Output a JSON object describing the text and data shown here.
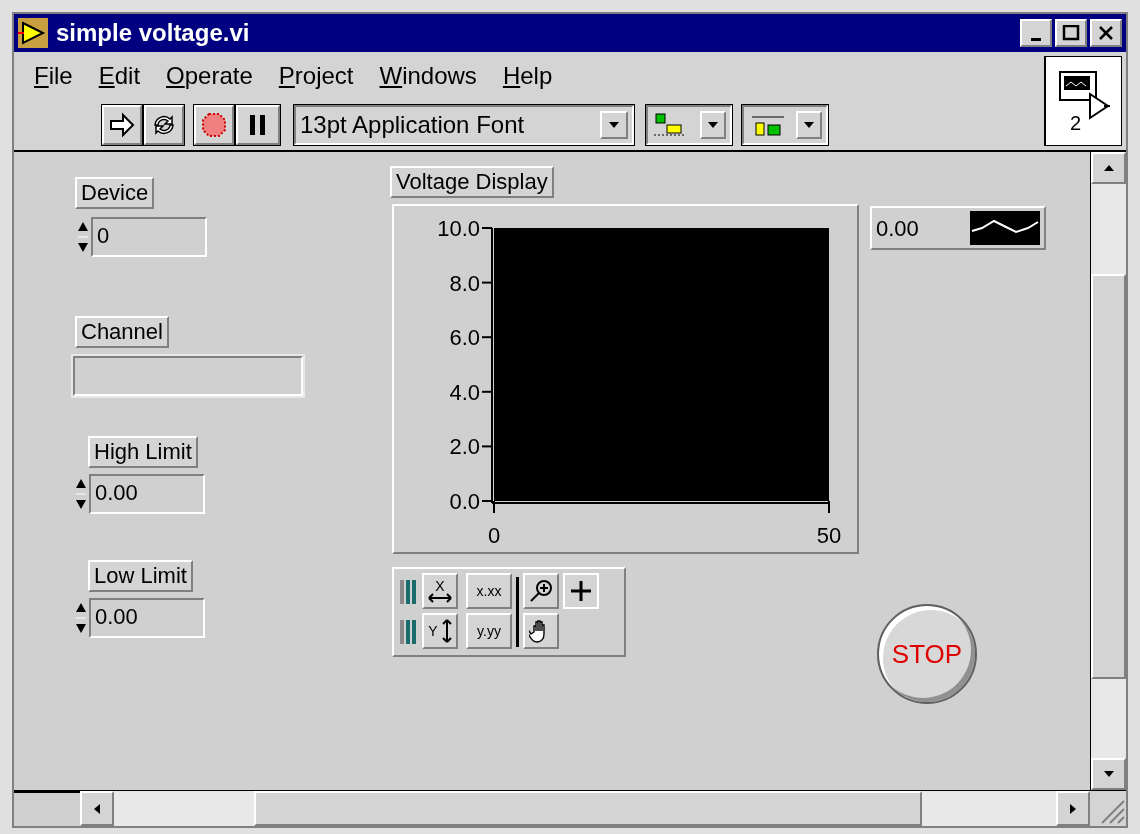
{
  "window": {
    "title": "simple voltage.vi"
  },
  "menu": [
    "File",
    "Edit",
    "Operate",
    "Project",
    "Windows",
    "Help"
  ],
  "toolbar": {
    "font": "13pt Application Font"
  },
  "connector": {
    "terminal_count": "2"
  },
  "controls": [
    {
      "kind": "numeric",
      "label": "Device",
      "value": "0"
    },
    {
      "kind": "channel",
      "label": "Channel"
    },
    {
      "kind": "numeric",
      "label": "High Limit",
      "value": "0.00"
    },
    {
      "kind": "numeric",
      "label": "Low Limit",
      "value": "0.00"
    }
  ],
  "graph": {
    "label": "Voltage Display",
    "digital_value": "0.00",
    "chart_data": {
      "type": "line",
      "xlim": [
        0,
        50
      ],
      "ylim": [
        0,
        10
      ],
      "xticks": [
        0,
        50
      ],
      "yticks": [
        {
          "value": 0,
          "label": "0.0"
        },
        {
          "value": 2,
          "label": "2.0"
        },
        {
          "value": 4,
          "label": "4.0"
        },
        {
          "value": 6,
          "label": "6.0"
        },
        {
          "value": 8,
          "label": "8.0"
        },
        {
          "value": 10,
          "label": "10.0"
        }
      ]
    }
  },
  "palette": {
    "x_scale": "X",
    "y_scale": "Y",
    "x_format": "x.xx",
    "y_format": "y.yy"
  },
  "stop_button": {
    "label": "STOP"
  }
}
